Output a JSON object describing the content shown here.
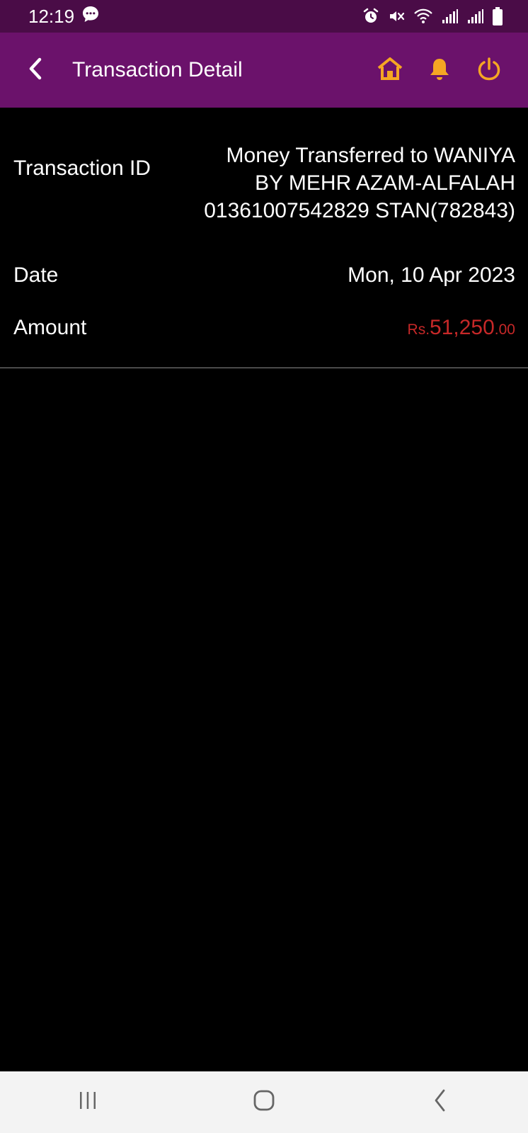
{
  "status_bar": {
    "time": "12:19",
    "icons": [
      "chat-bubble-icon",
      "alarm-icon",
      "mute-icon",
      "wifi-icon",
      "signal-icon",
      "signal-icon",
      "battery-icon"
    ]
  },
  "app_bar": {
    "title": "Transaction Detail",
    "icons": [
      "back-chevron-icon",
      "home-icon",
      "bell-icon",
      "power-icon"
    ],
    "accent_color": "#f5a623",
    "background_color": "#6b126b"
  },
  "details": {
    "transaction_id_label": "Transaction ID",
    "transaction_id_lines": [
      "Money Transferred to WANIYA",
      "BY MEHR AZAM-ALFALAH",
      "01361007542829 STAN(782843)"
    ],
    "date_label": "Date",
    "date_value": "Mon, 10 Apr 2023",
    "amount_label": "Amount",
    "amount_currency": "Rs.",
    "amount_main": "51,250",
    "amount_decimal": ".00",
    "amount_color": "#c62828"
  },
  "nav_bar": {
    "icons": [
      "recents-icon",
      "home-circle-icon",
      "back-icon"
    ]
  }
}
